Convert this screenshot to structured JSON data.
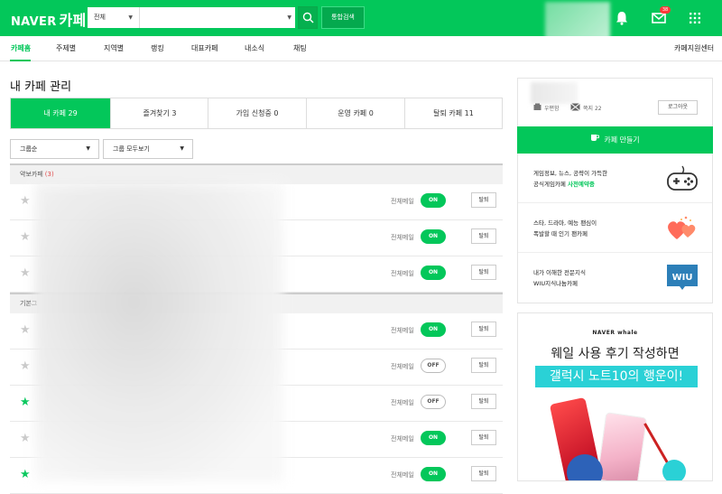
{
  "header": {
    "logo_brand": "NAVER",
    "logo_service": "카페",
    "search_scope": "전체",
    "search_placeholder": "",
    "total_search_label": "통합검색",
    "mail_badge": "38"
  },
  "gnb": {
    "items": [
      "카페홈",
      "주제별",
      "지역별",
      "랭킹",
      "대표카페",
      "내소식",
      "채팅"
    ],
    "right_link": "카페지원센터"
  },
  "main": {
    "title": "내 카페 관리",
    "tabs": [
      "내 카페 29",
      "즐겨찾기 3",
      "가입 신청중 0",
      "운영 카페 0",
      "탈퇴 카페 11"
    ],
    "filters": [
      "그룹순",
      "그룹 모두보기"
    ],
    "groups": [
      {
        "name": "약보카페",
        "count": "(3)"
      },
      {
        "name": "기본그"
      }
    ],
    "row_label": "전체메일",
    "leave_label": "탈퇴",
    "toggle_on": "ON",
    "toggle_off": "OFF",
    "rows": [
      {
        "starred": false,
        "mail": "ON"
      },
      {
        "starred": false,
        "mail": "ON"
      },
      {
        "starred": false,
        "mail": "ON"
      },
      {
        "starred": false,
        "mail": "ON"
      },
      {
        "starred": false,
        "mail": "OFF"
      },
      {
        "starred": true,
        "mail": "OFF"
      },
      {
        "starred": false,
        "mail": "ON"
      },
      {
        "starred": true,
        "mail": "ON"
      }
    ]
  },
  "side": {
    "profile_meta_1": "우편함",
    "profile_meta_2": "쪽지 22",
    "logout_label": "로그아웃",
    "make_cafe_label": "카페 만들기",
    "promos": [
      {
        "line1": "게임정보, 뉴스, 공략이 가득한",
        "line2_prefix": "공식게임카페 ",
        "line2_highlight": "사전예약중",
        "icon": "gamepad-icon"
      },
      {
        "line1": "스타, 드라마, 예능 팬심이",
        "line2_prefix": "폭발할 때 인기 팬카페",
        "line2_highlight": "",
        "icon": "hearts-icon"
      },
      {
        "line1": "내가 이해한 전문지식",
        "line2_prefix": "WIU지식나눔카페",
        "line2_highlight": "",
        "icon": "wiu-logo-icon"
      }
    ],
    "ad": {
      "brand": "NAVER whale",
      "line1": "웨일 사용 후기 작성하면",
      "line2": "갤럭시 노트10의 행운이!"
    }
  },
  "colors": {
    "accent": "#03c75a",
    "badge": "#ff3a3a"
  }
}
